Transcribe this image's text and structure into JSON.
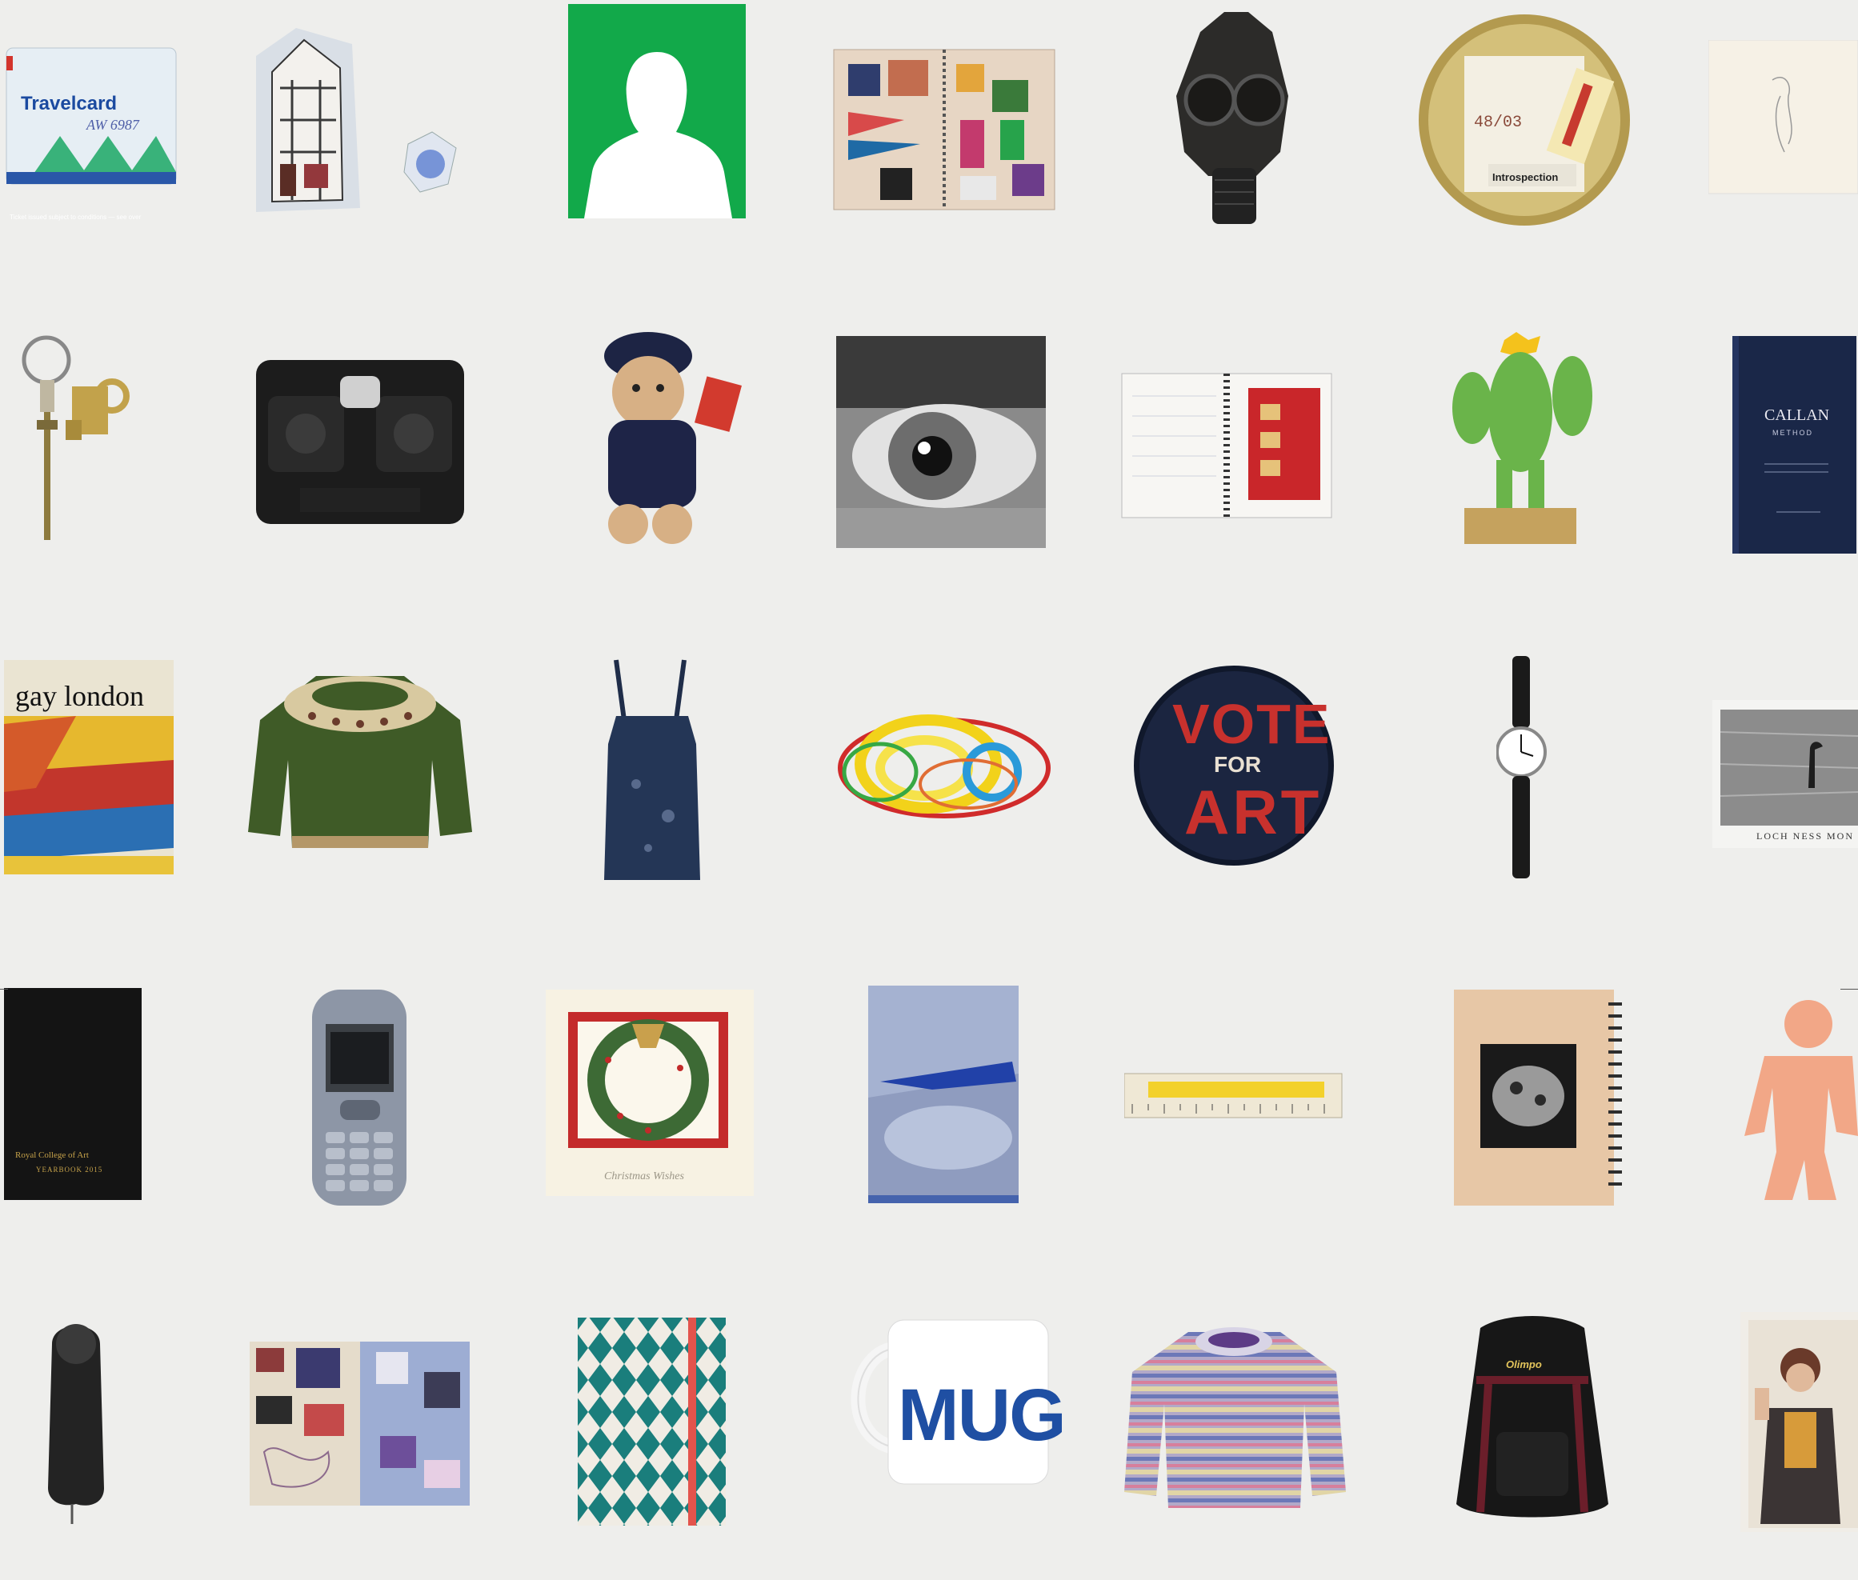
{
  "colors": {
    "background": "#eeeeec",
    "green_card": "#12a94a",
    "navy": "#1a2748",
    "sweater_green": "#3f5b27",
    "vote_red": "#c8312d",
    "mug_blue": "#1f4fa3",
    "figurine_pink": "#f2a787"
  },
  "objects": {
    "travelcard": {
      "title": "Travelcard",
      "number": "AW 6987",
      "footer": "Ticket issued subject to conditions — see over",
      "icon": "travelcard-icon"
    },
    "house_illustration": {
      "icon": "house-illustration-icon"
    },
    "silhouette": {
      "icon": "silhouette-icon"
    },
    "scrapbook": {
      "icon": "scrapbook-icon"
    },
    "gas_mask": {
      "icon": "gas-mask-icon"
    },
    "film_can": {
      "label": "Introspection",
      "number": "48/03",
      "icon": "film-can-icon"
    },
    "sketch_paper": {
      "icon": "sketch-icon"
    },
    "keys": {
      "icon": "keys-icon"
    },
    "viewmaster": {
      "icon": "viewmaster-icon"
    },
    "police_bear": {
      "icon": "teddy-bear-icon"
    },
    "eye_photo": {
      "icon": "eye-photo-icon"
    },
    "notebook": {
      "icon": "notebook-icon"
    },
    "cactus": {
      "icon": "cactus-icon"
    },
    "callan_book": {
      "title": "CALLAN",
      "subtitle": "METHOD",
      "icon": "book-icon"
    },
    "gay_london_book": {
      "title": "gay london",
      "icon": "book-icon"
    },
    "sweater": {
      "icon": "sweater-icon"
    },
    "apron": {
      "icon": "apron-icon"
    },
    "wires": {
      "icon": "wires-icon"
    },
    "vote_badge": {
      "line1": "VOTE",
      "line2": "FOR",
      "line3": "ART",
      "icon": "badge-icon"
    },
    "wristwatch": {
      "icon": "watch-icon"
    },
    "loch_ness_postcard": {
      "caption": "LOCH NESS MON",
      "icon": "postcard-icon"
    },
    "yearbook": {
      "line1": "Royal College of Art",
      "line2": "YEARBOOK 2015",
      "icon": "book-icon"
    },
    "phone": {
      "icon": "mobile-phone-icon"
    },
    "wreath_card": {
      "caption": "Christmas Wishes",
      "icon": "wreath-card-icon"
    },
    "blue_print": {
      "icon": "print-icon"
    },
    "ruler": {
      "icon": "ruler-icon"
    },
    "spiral_notebook": {
      "icon": "spiral-notebook-icon"
    },
    "pink_figurine": {
      "icon": "figurine-icon"
    },
    "finger": {
      "icon": "finger-sculpture-icon"
    },
    "collage": {
      "icon": "collage-icon"
    },
    "harlequin_notebook": {
      "icon": "notebook-icon"
    },
    "mug": {
      "text": "MUG",
      "icon": "mug-icon"
    },
    "knit_jumper": {
      "icon": "jumper-icon"
    },
    "backpack": {
      "brand": "Olimpo",
      "icon": "backpack-icon"
    },
    "photo_print": {
      "icon": "photo-icon"
    }
  }
}
